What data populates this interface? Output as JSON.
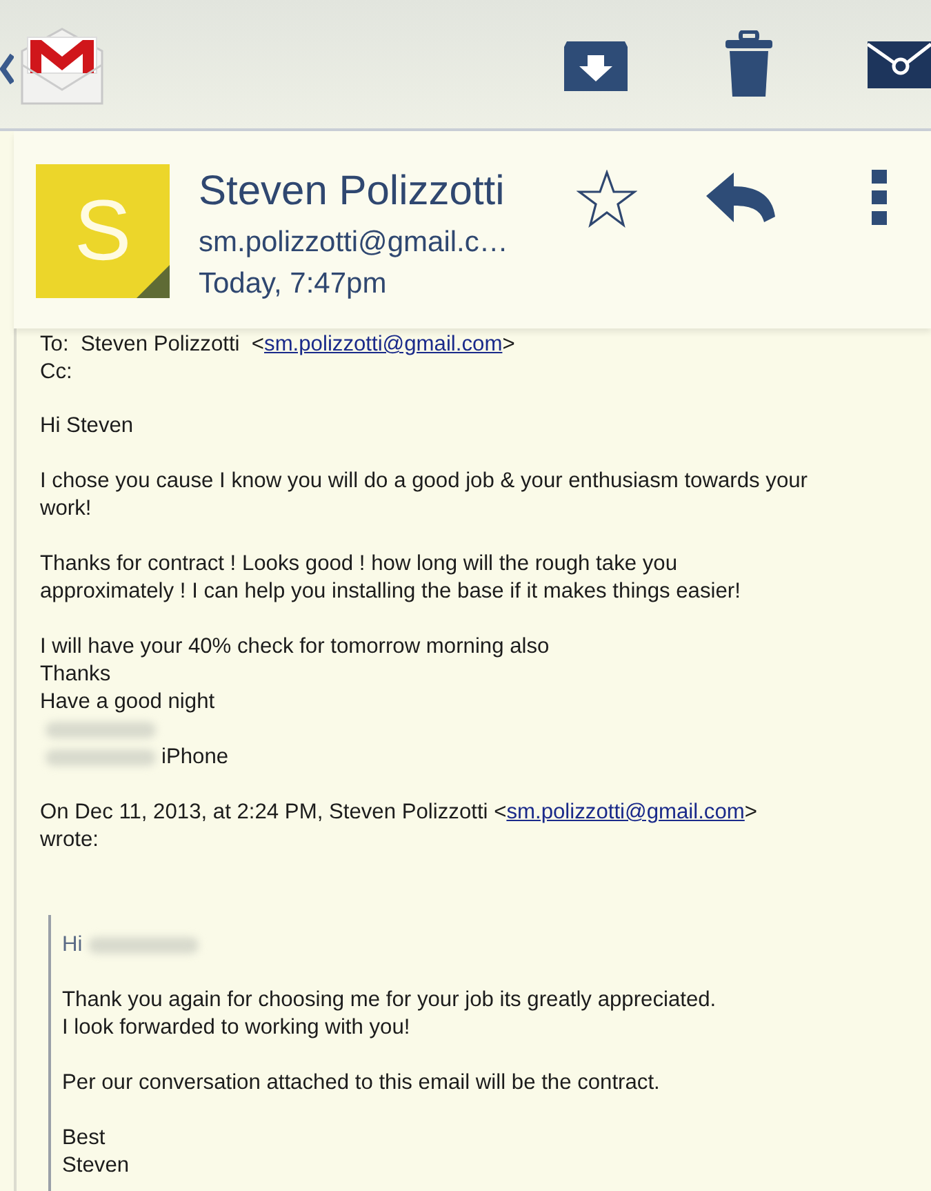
{
  "header": {
    "avatar_letter": "S",
    "sender_name": "Steven Polizzotti",
    "sender_email": "sm.polizzotti@gmail.c…",
    "time": "Today, 7:47pm",
    "starred": false
  },
  "body": {
    "to_line": {
      "label": "To:",
      "name": "Steven Polizzotti",
      "email": "sm.polizzotti@gmail.com",
      "open_bracket": "<",
      "close_bracket": ">"
    },
    "cc_label": "Cc:",
    "blocks": [
      {
        "kind": "text",
        "lines": [
          "Hi Steven"
        ]
      },
      {
        "kind": "text",
        "lines": [
          "I chose you cause I know you will do a good job & your enthusiasm towards your",
          "work!"
        ]
      },
      {
        "kind": "text",
        "lines": [
          "Thanks for contract ! Looks good ! how long will the rough take you",
          "approximately ! I can help you installing the base if it makes things easier!"
        ]
      },
      {
        "kind": "lines",
        "items": [
          {
            "text": "I will have your 40% check for tomorrow morning also",
            "kind": "plain"
          },
          {
            "text": "Thanks",
            "kind": "plain"
          },
          {
            "text": "Have a good night",
            "kind": "plain"
          },
          {
            "kind": "blurred"
          },
          {
            "text": "iPhone",
            "kind": "blurred-prefix"
          }
        ]
      }
    ],
    "quote_header": {
      "before": "On Dec 11, 2013, at 2:24 PM, Steven Polizzotti <",
      "email": "sm.polizzotti@gmail.com",
      "after": ">",
      "line2": "wrote:"
    },
    "quote_blocks": [
      {
        "kind": "lines",
        "items": [
          {
            "text": "Hi",
            "kind": "blurred-suffix"
          }
        ]
      },
      {
        "kind": "text",
        "lines": [
          "Thank you again for choosing me for your job its greatly appreciated.",
          "I look forwarded to working with you!"
        ]
      },
      {
        "kind": "text",
        "lines": [
          "Per our conversation attached to this email will be the contract."
        ]
      },
      {
        "kind": "text",
        "lines": [
          "Best",
          "Steven"
        ]
      }
    ]
  }
}
